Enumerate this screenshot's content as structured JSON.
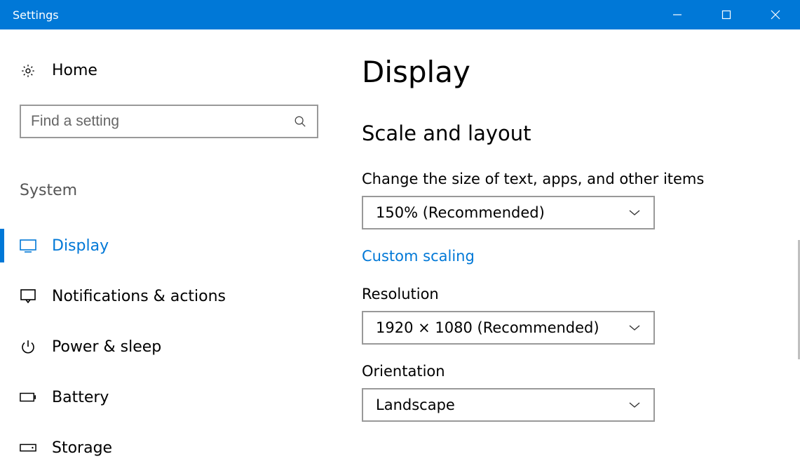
{
  "window": {
    "title": "Settings"
  },
  "sidebar": {
    "home_label": "Home",
    "search_placeholder": "Find a setting",
    "category": "System",
    "items": [
      {
        "label": "Display",
        "active": true
      },
      {
        "label": "Notifications & actions",
        "active": false
      },
      {
        "label": "Power & sleep",
        "active": false
      },
      {
        "label": "Battery",
        "active": false
      },
      {
        "label": "Storage",
        "active": false
      }
    ]
  },
  "main": {
    "title": "Display",
    "section": "Scale and layout",
    "scale_label": "Change the size of text, apps, and other items",
    "scale_value": "150% (Recommended)",
    "custom_scaling": "Custom scaling",
    "resolution_label": "Resolution",
    "resolution_value": "1920 × 1080 (Recommended)",
    "orientation_label": "Orientation",
    "orientation_value": "Landscape"
  }
}
